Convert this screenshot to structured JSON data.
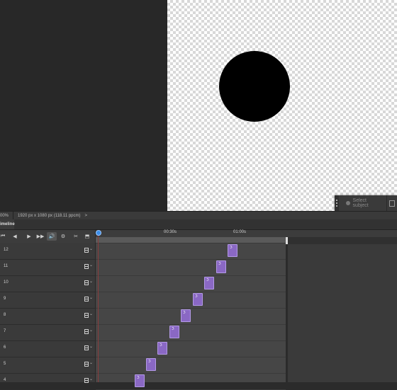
{
  "statusbar": {
    "zoom": "00%",
    "doc_info": "1920 px x 1080 px (118.11 ppcm)",
    "arrow": ">"
  },
  "context_bar": {
    "select_subject_label": "Select subject"
  },
  "timeline": {
    "panel_tab": "imeline",
    "ruler_labels": [
      "00:30s",
      "01:00s"
    ],
    "controls": [
      "⏮",
      "◀",
      "▶",
      "▶▶",
      "🔊",
      "⚙",
      "✂",
      "⬒"
    ],
    "layers": [
      {
        "name": "12"
      },
      {
        "name": "11"
      },
      {
        "name": "10"
      },
      {
        "name": "9"
      },
      {
        "name": "8"
      },
      {
        "name": "7"
      },
      {
        "name": "6"
      },
      {
        "name": "5"
      },
      {
        "name": "4"
      }
    ],
    "clip_glyph": "ℑ",
    "chevron": "⌄"
  },
  "colors": {
    "clip": "#8a68c4",
    "playhead": "#3c8de8"
  }
}
